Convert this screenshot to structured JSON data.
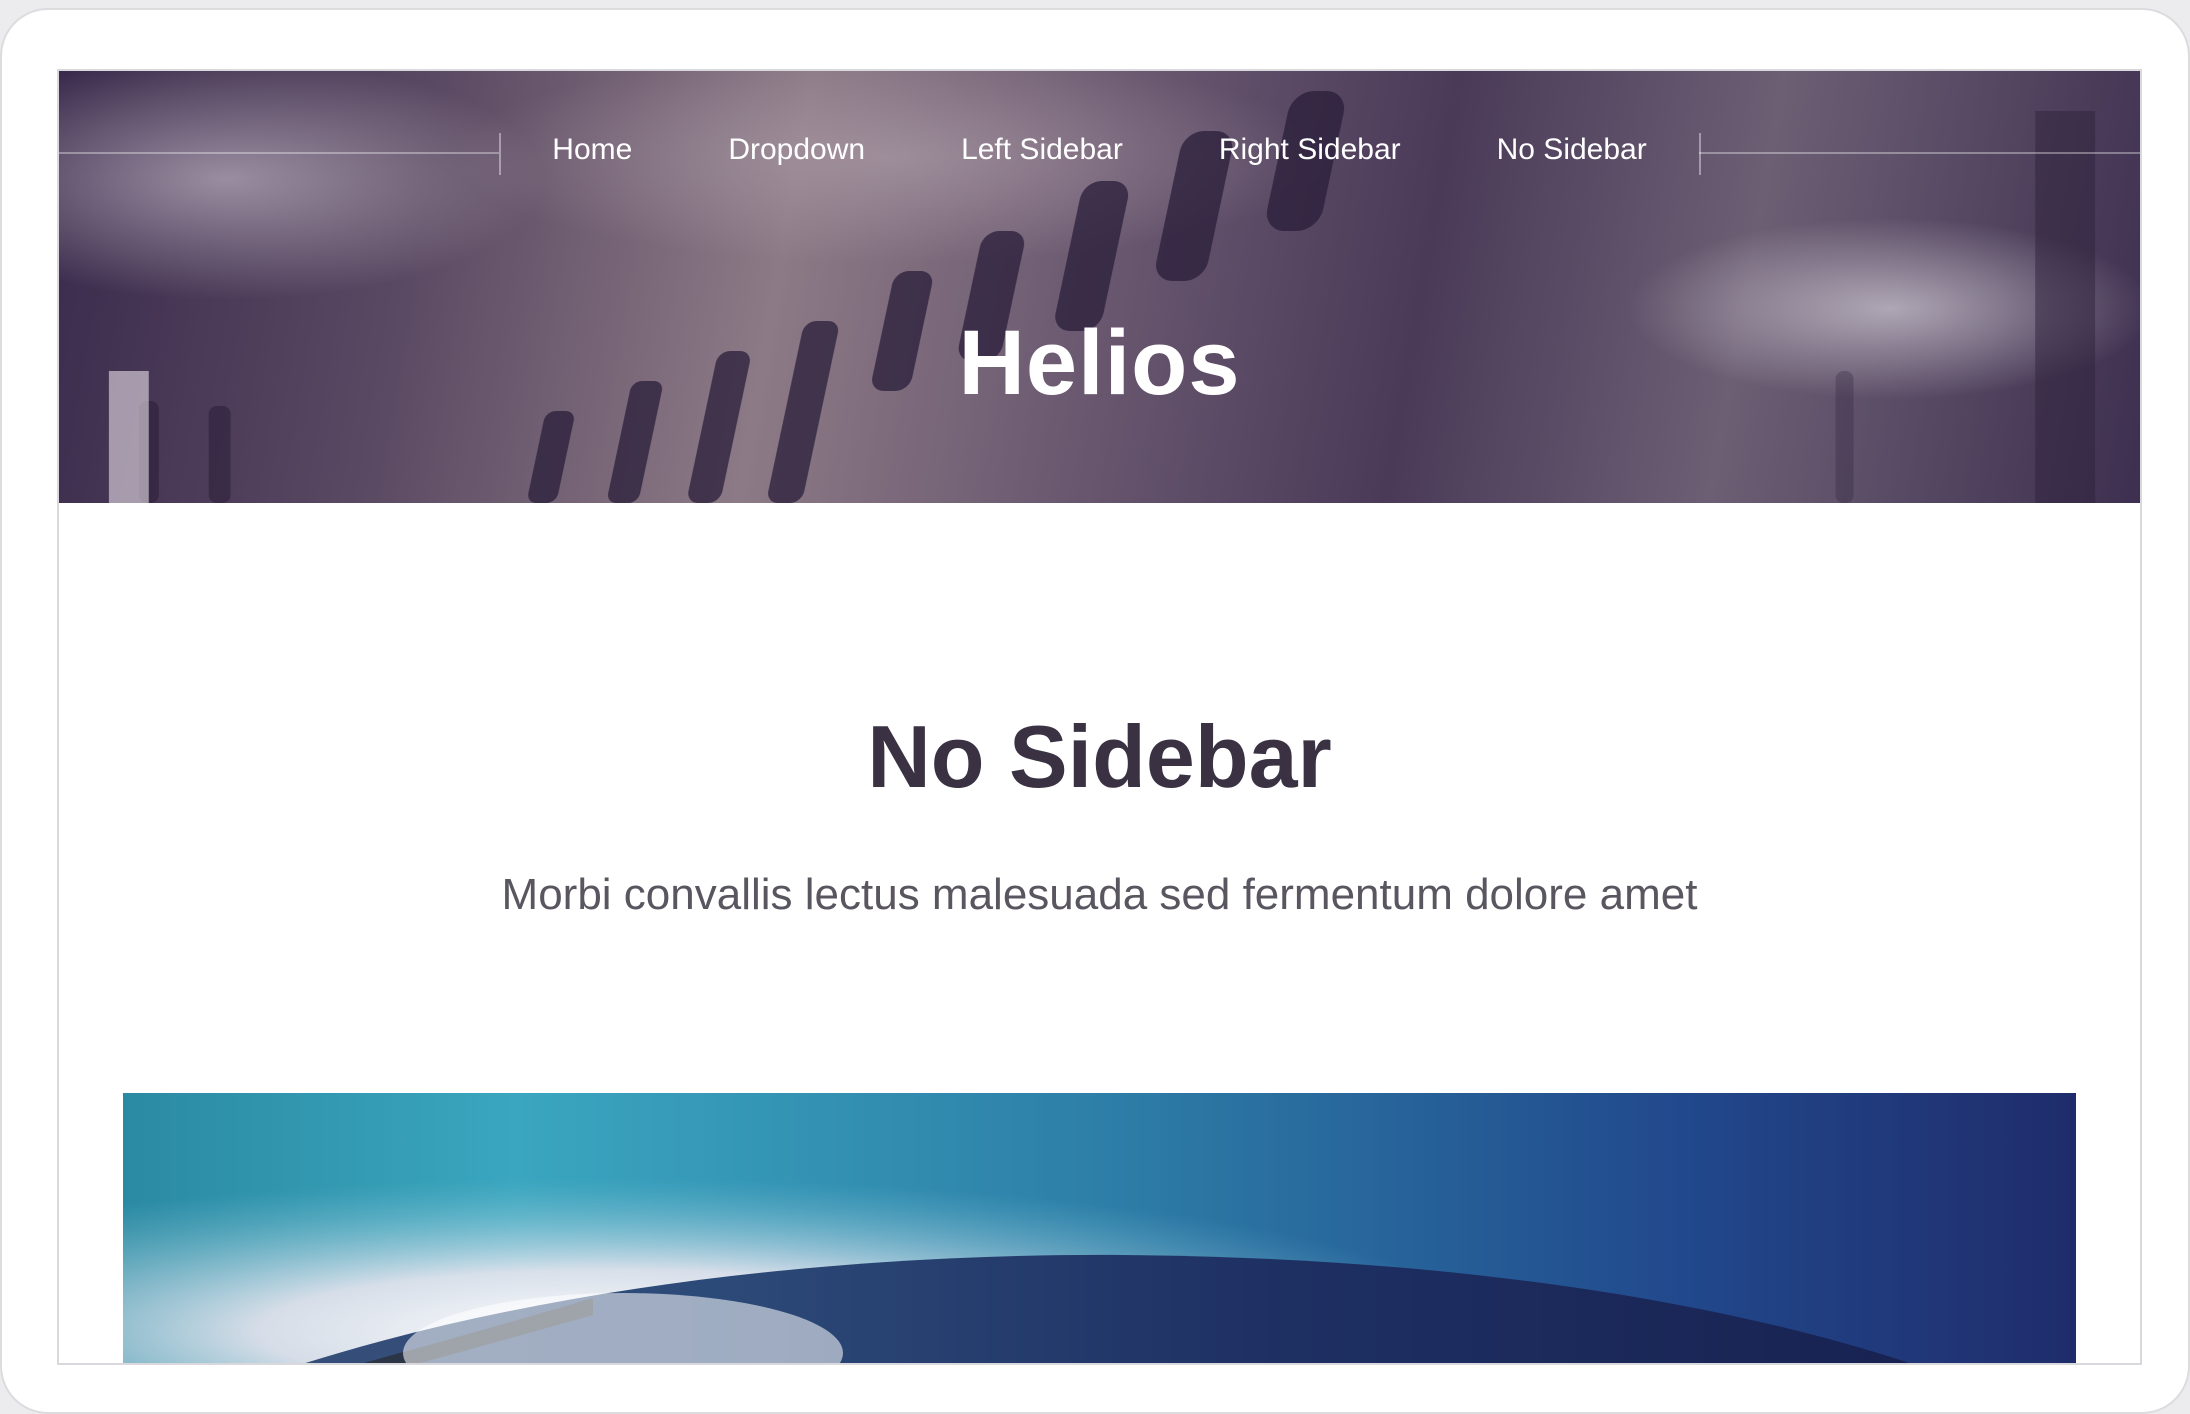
{
  "nav": {
    "items": [
      {
        "label": "Home"
      },
      {
        "label": "Dropdown"
      },
      {
        "label": "Left Sidebar"
      },
      {
        "label": "Right Sidebar"
      },
      {
        "label": "No Sidebar"
      }
    ]
  },
  "header": {
    "site_title": "Helios"
  },
  "main": {
    "title": "No Sidebar",
    "subtitle": "Morbi convallis lectus malesuada sed fermentum dolore amet"
  },
  "colors": {
    "header_tint": "#4a3a58",
    "title_text": "#3a3243",
    "subtitle_text": "#5a5660"
  }
}
